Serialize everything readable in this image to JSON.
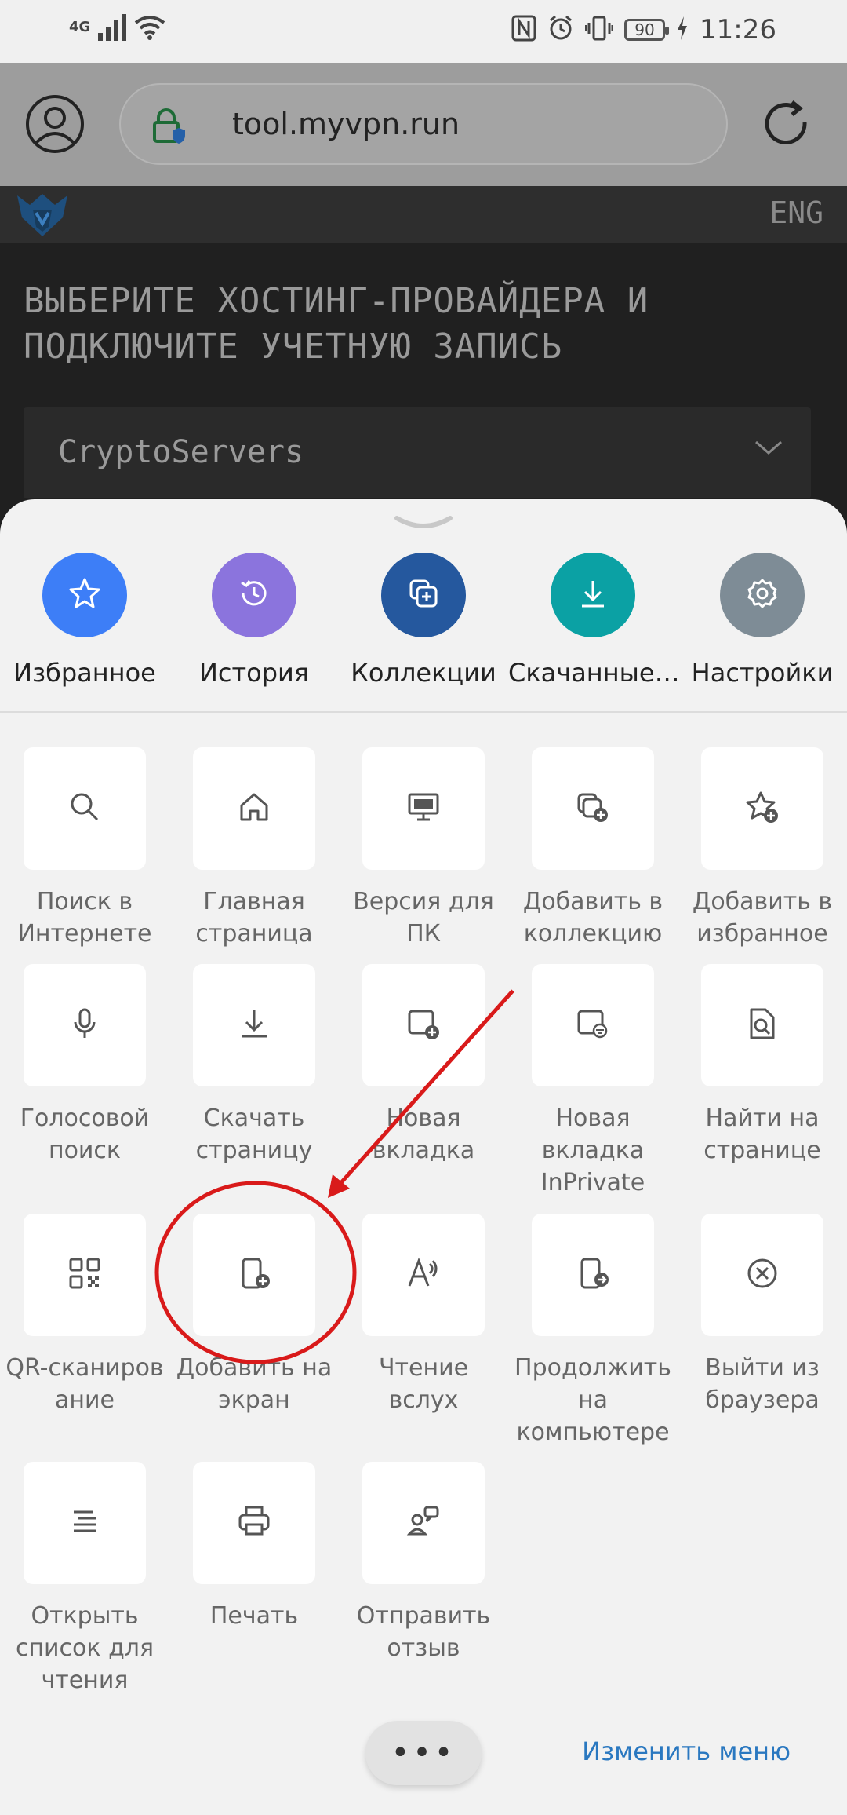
{
  "status_bar": {
    "network": "4G",
    "time": "11:26",
    "battery": "90"
  },
  "browser": {
    "url": "tool.myvpn.run"
  },
  "site": {
    "lang": "ENG",
    "title": "ВЫБЕРИТЕ ХОСТИНГ-ПРОВАЙДЕРА И ПОДКЛЮЧИТЕ УЧЕТНУЮ ЗАПИСЬ",
    "select_value": "CryptoServers"
  },
  "quick_actions": [
    {
      "label": "Избранное",
      "icon": "star-icon",
      "color": "#3d7ef7"
    },
    {
      "label": "История",
      "icon": "history-icon",
      "color": "#8b74dd"
    },
    {
      "label": "Коллекции",
      "icon": "collections-icon",
      "color": "#25589e"
    },
    {
      "label": "Скачанные…",
      "icon": "download-icon",
      "color": "#0ba1a4"
    },
    {
      "label": "Настройки",
      "icon": "gear-icon",
      "color": "#7e8c96"
    }
  ],
  "menu": [
    {
      "label": "Поиск в Интернете",
      "icon": "search-icon"
    },
    {
      "label": "Главная страница",
      "icon": "home-icon"
    },
    {
      "label": "Версия для ПК",
      "icon": "desktop-icon"
    },
    {
      "label": "Добавить в коллекцию",
      "icon": "add-collection-icon"
    },
    {
      "label": "Добавить в избранное",
      "icon": "add-favorite-icon"
    },
    {
      "label": "Голосовой поиск",
      "icon": "microphone-icon"
    },
    {
      "label": "Скачать страницу",
      "icon": "download-icon"
    },
    {
      "label": "Новая вкладка",
      "icon": "new-tab-icon"
    },
    {
      "label": "Новая вкладка InPrivate",
      "icon": "inprivate-tab-icon"
    },
    {
      "label": "Найти на странице",
      "icon": "find-in-page-icon"
    },
    {
      "label": "QR-сканиров ание",
      "icon": "qr-icon"
    },
    {
      "label": "Добавить на экран",
      "icon": "add-to-screen-icon"
    },
    {
      "label": "Чтение вслух",
      "icon": "read-aloud-icon"
    },
    {
      "label": "Продолжить на компьютере",
      "icon": "continue-on-pc-icon"
    },
    {
      "label": "Выйти из браузера",
      "icon": "exit-icon"
    },
    {
      "label": "Открыть список для чтения",
      "icon": "reading-list-icon"
    },
    {
      "label": "Печать",
      "icon": "print-icon"
    },
    {
      "label": "Отправить отзыв",
      "icon": "feedback-icon"
    }
  ],
  "footer": {
    "more_label": "•••",
    "edit_label": "Изменить меню"
  },
  "annotation_color": "#d91a1a"
}
